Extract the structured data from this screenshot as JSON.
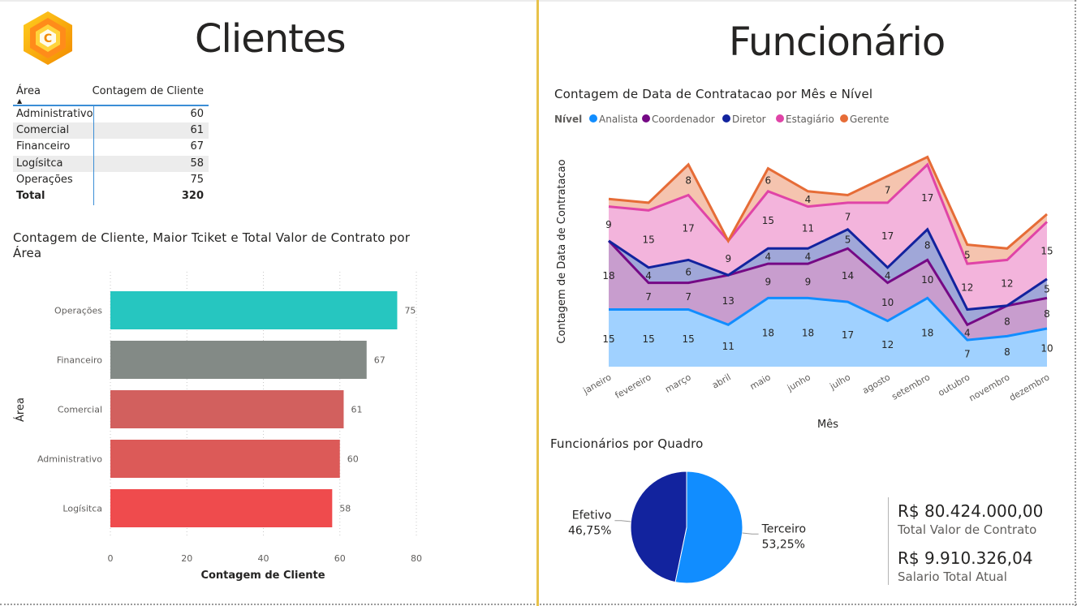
{
  "clientes": {
    "title": "Clientes",
    "table": {
      "col_area": "Área",
      "col_count": "Contagem de Cliente",
      "rows": [
        {
          "area": "Administrativo",
          "count": "60"
        },
        {
          "area": "Comercial",
          "count": "61"
        },
        {
          "area": "Financeiro",
          "count": "67"
        },
        {
          "area": "Logísitca",
          "count": "58"
        },
        {
          "area": "Operações",
          "count": "75"
        }
      ],
      "total_label": "Total",
      "total_value": "320"
    }
  },
  "funcionario": {
    "title": "Funcionário",
    "kpis": [
      {
        "value": "R$ 80.424.000,00",
        "label": "Total Valor de Contrato"
      },
      {
        "value": "R$ 9.910.326,04",
        "label": "Salario Total Atual"
      }
    ]
  },
  "chart_data": [
    {
      "type": "bar",
      "orientation": "horizontal",
      "title": "Contagem de Cliente, Maior Tciket e Total Valor de Contrato por Área",
      "title_lines": [
        "Contagem de Cliente, Maior Tciket e Total Valor de Contrato por",
        "Área"
      ],
      "xlabel": "Contagem de Cliente",
      "ylabel": "Área",
      "xlim": [
        0,
        80
      ],
      "xticks": [
        0,
        20,
        40,
        60,
        80
      ],
      "categories": [
        "Operações",
        "Financeiro",
        "Comercial",
        "Administrativo",
        "Logísitca"
      ],
      "values": [
        75,
        67,
        61,
        60,
        58
      ],
      "colors": [
        "#26c6c0",
        "#838a86",
        "#d2605e",
        "#dc5a58",
        "#ef4b4d"
      ],
      "grid": "vertical dotted"
    },
    {
      "type": "area",
      "stacked": true,
      "title": "Contagem de Data de Contratacao por Mês e Nível",
      "xlabel": "Mês",
      "ylabel": "Contagem de Data de Contratacao",
      "legend_title": "Nível",
      "legend_position": "top-left",
      "categories": [
        "janeiro",
        "fevereiro",
        "março",
        "abril",
        "maio",
        "junho",
        "julho",
        "agosto",
        "setembro",
        "outubro",
        "novembro",
        "dezembro"
      ],
      "series": [
        {
          "name": "Analista",
          "color": "#118dff",
          "values": [
            15,
            15,
            15,
            11,
            18,
            18,
            17,
            12,
            18,
            7,
            8,
            10
          ]
        },
        {
          "name": "Coordenador",
          "color": "#750985",
          "values": [
            18,
            7,
            7,
            13,
            9,
            9,
            14,
            10,
            10,
            4,
            8,
            8
          ]
        },
        {
          "name": "Diretor",
          "color": "#12239e",
          "values": [
            0,
            4,
            6,
            0,
            4,
            4,
            5,
            4,
            8,
            4,
            0,
            5
          ]
        },
        {
          "name": "Estagiário",
          "color": "#e044a7",
          "values": [
            9,
            15,
            17,
            9,
            15,
            11,
            7,
            17,
            17,
            12,
            12,
            15
          ]
        },
        {
          "name": "Gerente",
          "color": "#e66c37",
          "values": [
            2,
            2,
            8,
            0,
            6,
            4,
            2,
            7,
            2,
            5,
            3,
            2
          ]
        }
      ],
      "data_labels": {
        "Analista": [
          "15",
          "15",
          "15",
          "11",
          "18",
          "18",
          "17",
          "12",
          "18",
          "7",
          "8",
          "10"
        ],
        "Coordenador": [
          "18",
          "7",
          "7",
          "13",
          "9",
          "9",
          "14",
          "10",
          "10",
          "4",
          "8",
          "8"
        ],
        "Diretor": [
          "",
          "4",
          "6",
          "",
          "4",
          "4",
          "5",
          "4",
          "8",
          "",
          "",
          "5"
        ],
        "Estagiário": [
          "9",
          "15",
          "17",
          "9",
          "15",
          "11",
          "7",
          "17",
          "17",
          "12",
          "12",
          "15"
        ],
        "Gerente": [
          "",
          "",
          "8",
          "",
          "6",
          "4",
          "",
          "7",
          "",
          "5",
          "",
          ""
        ]
      }
    },
    {
      "type": "pie",
      "title": "Funcionários por Quadro",
      "slices": [
        {
          "name": "Terceiro",
          "value": 53.25,
          "label": "53,25%",
          "color": "#118dff"
        },
        {
          "name": "Efetivo",
          "value": 46.75,
          "label": "46,75%",
          "color": "#12239e"
        }
      ]
    }
  ]
}
